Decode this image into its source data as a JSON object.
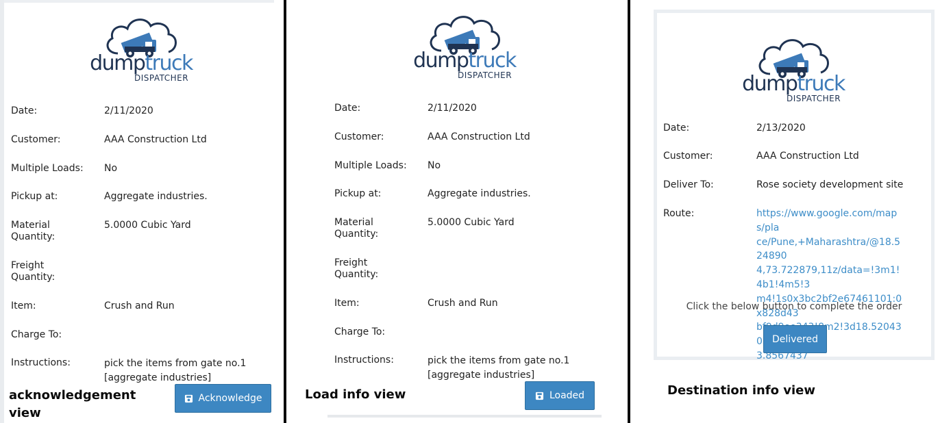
{
  "brand": {
    "word1": "dump",
    "word2": "truck",
    "sub": "DISPATCHER"
  },
  "colors": {
    "brand_dark": "#1f3352",
    "brand_blue": "#3d7ab8",
    "button": "#3d87c2",
    "link": "#3d8dc8"
  },
  "labels": {
    "date": "Date:",
    "customer": "Customer:",
    "multiple_loads": "Multiple Loads:",
    "pickup": "Pickup at:",
    "material_quantity": "Material Quantity:",
    "freight_quantity": "Freight Quantity:",
    "item": "Item:",
    "charge_to": "Charge To:",
    "instructions": "Instructions:",
    "deliver_to": "Deliver To:",
    "route": "Route:"
  },
  "ack_view": {
    "date": "2/11/2020",
    "customer": "AAA Construction Ltd",
    "multiple_loads": "No",
    "pickup": "Aggregate industries.",
    "material_quantity": "5.0000 Cubic Yard",
    "freight_quantity": "",
    "item": "Crush and Run",
    "charge_to": "",
    "instructions_line1": "pick the items from gate no.1",
    "instructions_line2": "[aggregate industries]",
    "button": {
      "label": "Acknowledge",
      "icon": "save-icon"
    },
    "caption_line1": "acknowledgement",
    "caption_line2": "view"
  },
  "load_view": {
    "date": "2/11/2020",
    "customer": "AAA Construction Ltd",
    "multiple_loads": "No",
    "pickup": "Aggregate industries.",
    "material_quantity": "5.0000 Cubic Yard",
    "freight_quantity": "",
    "item": "Crush and Run",
    "charge_to": "",
    "instructions_line1": "pick the items from gate no.1",
    "instructions_line2": "[aggregate industries]",
    "button": {
      "label": "Loaded",
      "icon": "save-icon"
    },
    "caption": "Load info view"
  },
  "destination_view": {
    "date": "2/13/2020",
    "customer": "AAA Construction Ltd",
    "deliver_to": "Rose society development site",
    "route_lines": [
      "https://www.google.com/maps/pla",
      "ce/Pune,+Maharashtra/@18.524890",
      "4,73.722879,11z/data=!3m1!4b1!4m5!3",
      "m4!1s0x3bc2bf2e67461101:0x828d43",
      "bf9d9ee343!8m2!3d18.5204303!4d7",
      "3.8567437"
    ],
    "complete_text": "Click the below button to complete the order",
    "button": {
      "label": "Delivered"
    },
    "caption": "Destination info view"
  }
}
